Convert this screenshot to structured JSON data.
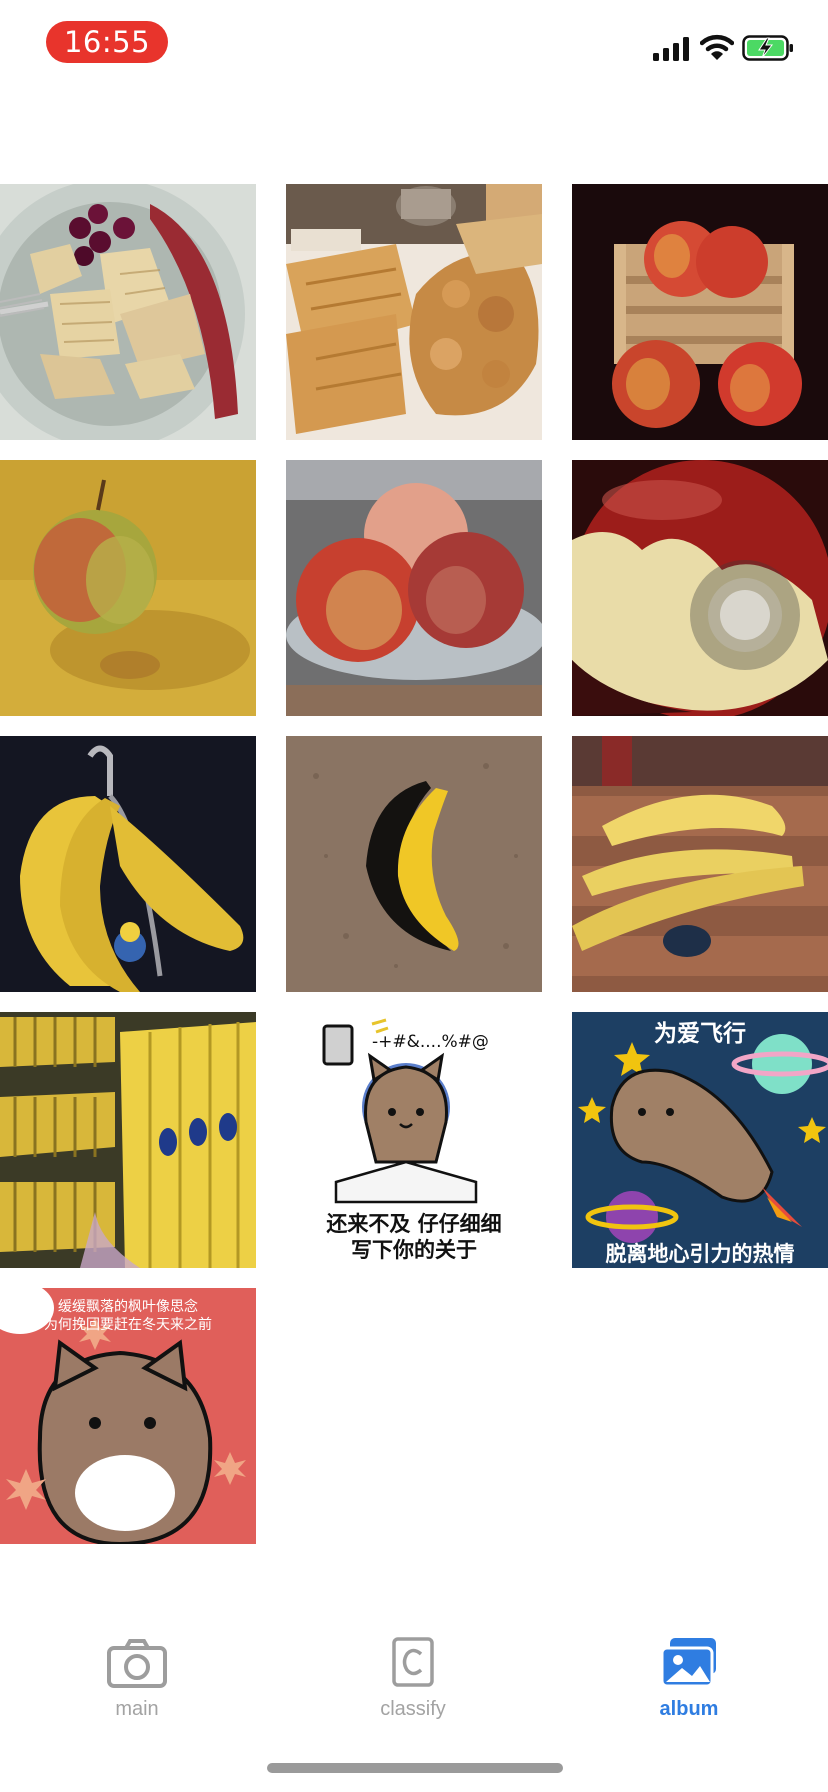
{
  "status_bar": {
    "time": "16:55",
    "time_pill_color": "#e8342c",
    "icons": [
      "cellular-signal-icon",
      "wifi-icon",
      "battery-charging-icon"
    ]
  },
  "album": {
    "photos": [
      {
        "name": "waffle-plate-photo"
      },
      {
        "name": "chicken-waffles-photo"
      },
      {
        "name": "apples-on-crate-photo"
      },
      {
        "name": "apple-on-table-photo"
      },
      {
        "name": "apples-in-bowl-photo"
      },
      {
        "name": "bitten-apple-photo"
      },
      {
        "name": "bananas-on-hook-photo"
      },
      {
        "name": "banana-on-ground-photo"
      },
      {
        "name": "bananas-on-bench-photo"
      },
      {
        "name": "banana-bunches-photo"
      },
      {
        "name": "cat-writing-sticker",
        "texts": [
          "-+#&....%#@",
          "还来不及 仔仔细细",
          "写下你的关于"
        ]
      },
      {
        "name": "cat-flying-sticker",
        "texts": [
          "为爱飞行",
          "脱离地心引力的热情"
        ]
      },
      {
        "name": "cat-maple-sticker",
        "texts": [
          "缓缓飘落的枫叶像思念",
          "为何挽回要赶在冬天来之前"
        ]
      }
    ]
  },
  "tab_bar": {
    "tabs": [
      {
        "label": "main",
        "icon": "camera-icon",
        "active": false
      },
      {
        "label": "classify",
        "icon": "classify-c-icon",
        "active": false
      },
      {
        "label": "album",
        "icon": "photos-icon",
        "active": true
      }
    ],
    "active_color": "#2f7de1",
    "inactive_color": "#a3a3a3"
  }
}
